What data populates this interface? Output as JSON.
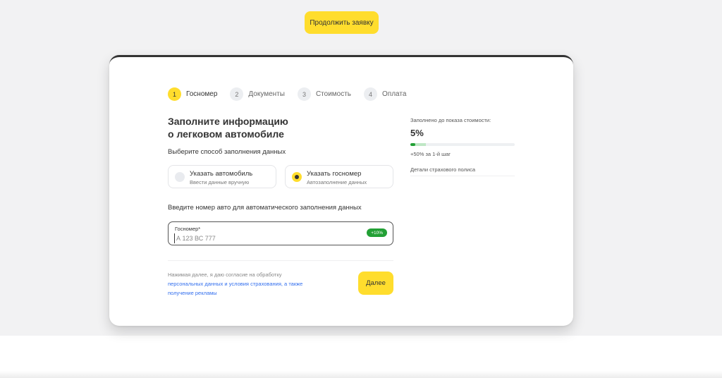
{
  "top": {
    "continue_label": "Продолжить заявку"
  },
  "steps": [
    {
      "num": "1",
      "label": "Госномер",
      "active": true
    },
    {
      "num": "2",
      "label": "Документы",
      "active": false
    },
    {
      "num": "3",
      "label": "Стоимость",
      "active": false
    },
    {
      "num": "4",
      "label": "Оплата",
      "active": false
    }
  ],
  "form": {
    "title_line1": "Заполните информацию",
    "title_line2": "о легковом автомобиле",
    "method_label": "Выберите способ заполнения данных",
    "options": [
      {
        "title": "Указать автомобиль",
        "subtitle": "Ввести данные вручную",
        "selected": false
      },
      {
        "title": "Указать госномер",
        "subtitle": "Автозаполнение данных",
        "selected": true
      }
    ],
    "auto_label": "Введите номер авто для автоматического заполнения данных",
    "plate": {
      "label": "Госномер*",
      "value": "",
      "placeholder": "А 123 ВС 777",
      "badge": "+10%"
    },
    "consent_text": "Нажимая далее, я даю согласие на обработку",
    "consent_link": "персональных данных и условия страхования, а также получение рекламы",
    "next_label": "Далее"
  },
  "progress": {
    "label": "Заполнено до показа стоимости:",
    "value_text": "5%",
    "value": 5,
    "bonus_until": 15,
    "hint": "+50% за 1-й шаг",
    "details": "Детали страхового полиса"
  },
  "colors": {
    "accent": "#ffdd2d",
    "success": "#22a035",
    "link": "#336fee",
    "text": "#333333"
  }
}
